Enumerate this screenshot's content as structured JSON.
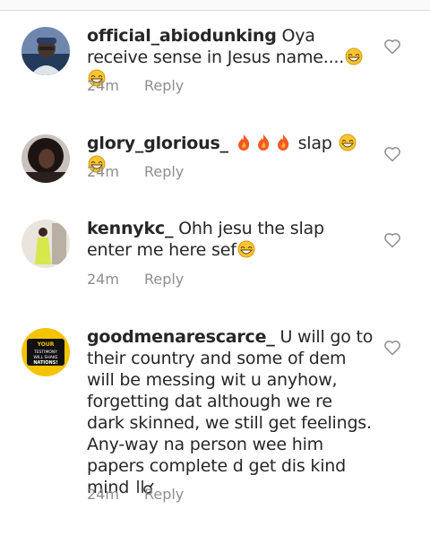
{
  "comments": [
    {
      "username": "official_abiodunking",
      "text": "Oya receive sense in Jesus name....",
      "emojis": [
        "grin-sweat-emoji",
        "grin-sweat-emoji"
      ],
      "time": "24m",
      "reply_label": "Reply"
    },
    {
      "username": "glory_glorious_",
      "text_before": "",
      "fire_emojis": [
        "fire-emoji",
        "fire-emoji",
        "fire-emoji"
      ],
      "text": "slap",
      "emojis": [
        "grin-sweat-emoji",
        "grin-sweat-emoji"
      ],
      "time": "24m",
      "reply_label": "Reply"
    },
    {
      "username": "kennykc_",
      "text": "Ohh jesu the slap enter me here sef",
      "emojis": [
        "grin-sweat-emoji"
      ],
      "time": "24m",
      "reply_label": "Reply"
    },
    {
      "username": "goodmenarescarce_",
      "text": "U will go to their country and some of dem will be messing wit u anyhow, forgetting dat although we re dark skinned, we still get feelings. Any-way na person wee him papers complete d get dis kind mind",
      "trailing_emoji": "male-sign-emoji",
      "avatar_text": "YOUR TESTIMONY WILL SHAKE NATIONS!",
      "time": "24m",
      "reply_label": "Reply"
    }
  ],
  "icons": {
    "heart": "heart-outline-icon"
  },
  "colors": {
    "text": "#262626",
    "muted": "#8e8e8e",
    "heart": "#8e8e8e"
  }
}
